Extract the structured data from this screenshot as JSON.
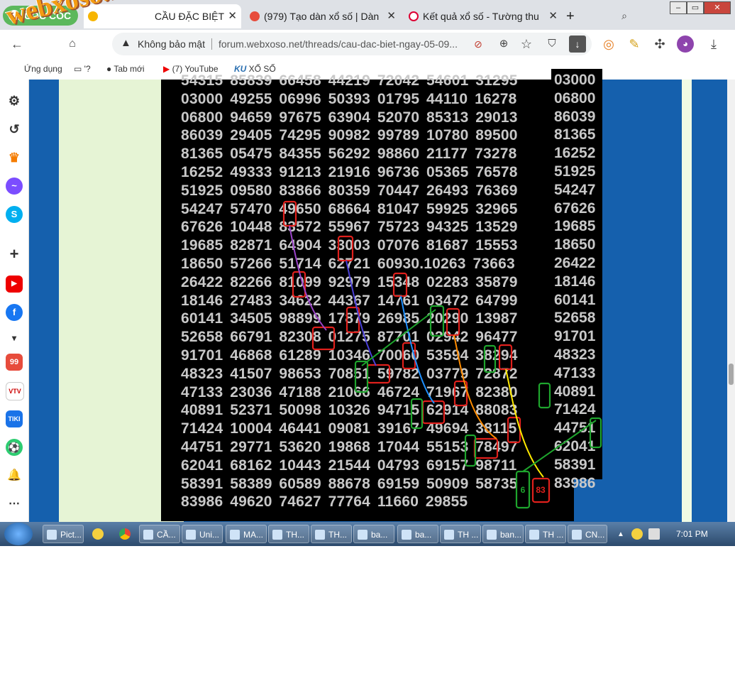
{
  "browser": {
    "app_name": "CỐC CỐC",
    "tabs": [
      {
        "label": "CẦU ĐẶC BIỆT",
        "active": true
      },
      {
        "label": "(979) Tạo dàn xổ số | Dàn",
        "active": false
      },
      {
        "label": "Kết quả xổ số - Tường thu",
        "active": false
      }
    ],
    "new_tab_symbol": "+",
    "window_controls": {
      "minimize": "–",
      "restore": "▭",
      "close": "✕"
    }
  },
  "addressbar": {
    "security_label": "Không bảo mật",
    "url": "forum.webxoso.net/threads/cau-dac-biet-ngay-05-09..."
  },
  "bookmarks": [
    {
      "label": "Ứng dụng",
      "icon": "apps-icon"
    },
    {
      "label": "'?",
      "icon": "folder-icon"
    },
    {
      "label": "Tab mới",
      "icon": "globe-icon"
    },
    {
      "label": "(7) YouTube",
      "icon": "youtube-icon"
    },
    {
      "label": "XỔ SỐ",
      "icon": "ku-icon"
    }
  ],
  "watermark": "webxoso.net",
  "sidebar_icons": [
    "settings-icon",
    "history-icon",
    "crown-icon",
    "messenger-icon",
    "skype-icon",
    "add-icon",
    "youtube-icon",
    "facebook-icon",
    "more-down-icon",
    "app-99-icon",
    "vtv-icon",
    "tiki-icon",
    "football-icon",
    "notification-icon",
    "more-icon"
  ],
  "board": {
    "rows": [
      "54315 85839 66458 44219 72042 54601 31295",
      "03000 49255 06996 50393 01795 44110 16278",
      "06800 94659 97675 63904 52070 85313 29013",
      "86039 29405 74295 90982 99789 10780 89500",
      "81365 05475 84355 56292 98860 21177 73278",
      "16252 49333 91213 21916 96736 05365 76578",
      "51925 09580 83866 80359 70447 26493 76369",
      "54247 57470 49650 68664 81047 59925 32965",
      "67626 10448 83572 55967 75723 94325 13529",
      "19685 82871 64904 33003 07076 81687 15553",
      "18650 57266 51714 62721 60930.10263 73663",
      "26422 82266 81099 92979 15348 02283 35879",
      "18146 27483 34622 44367 14761 03472 64799",
      "60141 34505 98899 17879 26985 20290 13987",
      "52658 66791 82308 01275 87701 02942 96477",
      "91701 46868 61289 10346 70060 53594 38294",
      "48323 41507 98653 70851 59782 03779 72872",
      "47133 23036 47188 21066 46724 71967 82380",
      "40891 52371 50098 10326 94715 62914 88083",
      "71424 10004 46441 09081 39167 49694 38115",
      "44751 29771 53620 19868 17044 55153 78497",
      "62041 68162 10443 21544 04793 69157 98711",
      "58391 58389 60589 88678 69159 50909 58735",
      "83986 49620 74627 77764 11660 29855"
    ],
    "tail_column": [
      "03000",
      "06800",
      "86039",
      "81365",
      "16252",
      "51925",
      "54247",
      "67626",
      "19685",
      "18650",
      "26422",
      "18146",
      "60141",
      "52658",
      "91701",
      "48323",
      "47133",
      "40891",
      "71424",
      "44751",
      "62041",
      "58391",
      "83986"
    ],
    "result_green": "6",
    "result_red": "83"
  },
  "taskbar": {
    "items": [
      "Pict...",
      "CẦ...",
      "Uni...",
      "MA...",
      "TH...",
      "TH...",
      "ba...",
      "ba...",
      "TH ...",
      "ban...",
      "TH ...",
      "CN..."
    ],
    "clock": "7:01 PM"
  },
  "colors": {
    "highlight_red": "#e0201c",
    "highlight_green": "#1ea52d",
    "board_bg": "#000000",
    "page_blue": "#1560ad"
  }
}
